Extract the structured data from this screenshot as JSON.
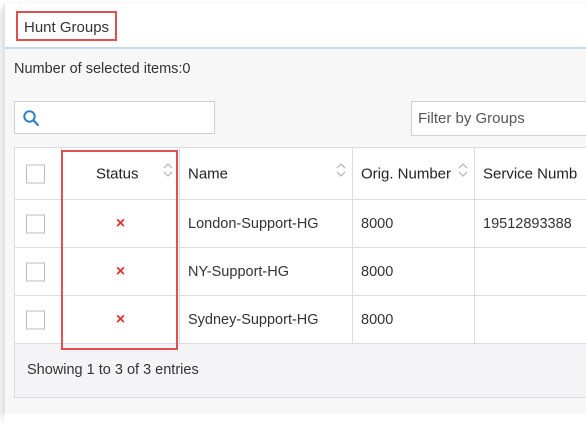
{
  "tab": {
    "title": "Hunt Groups"
  },
  "selection": {
    "label": "Number of selected items:0"
  },
  "search": {
    "placeholder": ""
  },
  "filter": {
    "placeholder": "Filter by Groups"
  },
  "table": {
    "columns": [
      "",
      "Status",
      "Name",
      "Orig. Number",
      "Service Numb"
    ],
    "rows": [
      {
        "status": "×",
        "name": "London-Support-HG",
        "orig": "8000",
        "service": "19512893388"
      },
      {
        "status": "×",
        "name": "NY-Support-HG",
        "orig": "8000",
        "service": ""
      },
      {
        "status": "×",
        "name": "Sydney-Support-HG",
        "orig": "8000",
        "service": ""
      }
    ]
  },
  "footer": {
    "text": "Showing 1 to 3 of 3 entries"
  },
  "colors": {
    "highlight": "#e05050",
    "error": "#d9322e",
    "accent": "#2f80c8"
  },
  "icons": {
    "search": "search-icon",
    "sort": "sort-icon",
    "status_error": "x-icon"
  }
}
